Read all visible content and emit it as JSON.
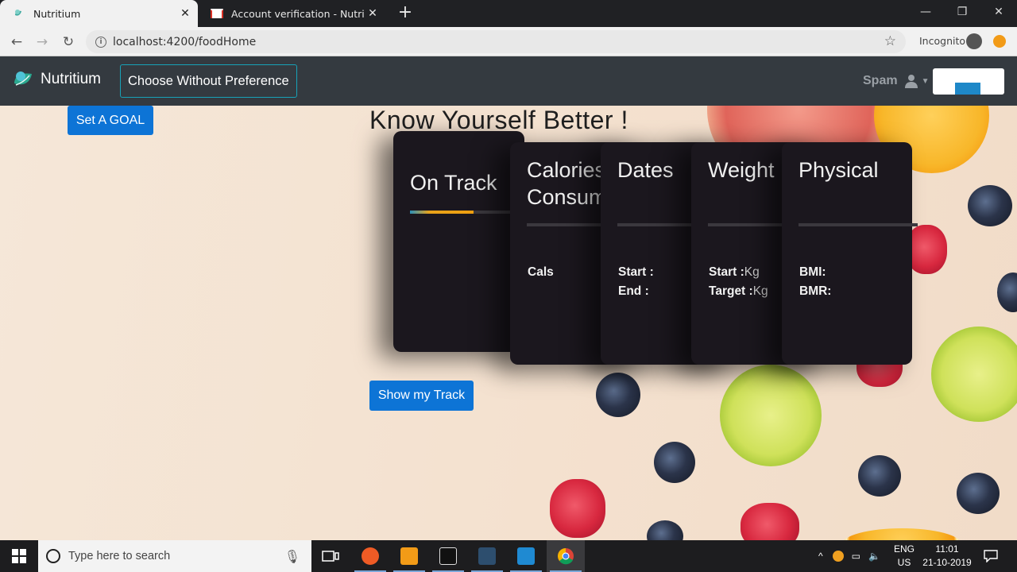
{
  "browser": {
    "tabs": [
      {
        "title": "Nutritium",
        "active": true
      },
      {
        "title": "Account verification - Nutritium -",
        "active": false
      }
    ],
    "url": "localhost:4200/foodHome",
    "incognito_label": "Incognito"
  },
  "navbar": {
    "brand": "Nutritium",
    "choose_label": "Choose Without Preference",
    "user_name": "Spam"
  },
  "page": {
    "goal_button": "Set A GOAL",
    "headline": "Know Yourself Better !",
    "track_button": "Show my Track",
    "on_track_progress_percent": 55
  },
  "cards": {
    "on_track": {
      "title": "On Track"
    },
    "calories": {
      "title": "Calories\nConsumed",
      "line1": "Cals"
    },
    "dates": {
      "title": "Dates",
      "line1": "Start :",
      "line2": "End :"
    },
    "weight": {
      "title": "Weight",
      "line1_label": "Start :",
      "line1_unit": "Kg",
      "line2_label": "Target :",
      "line2_unit": "Kg"
    },
    "physical": {
      "title": "Physical",
      "line1": "BMI:",
      "line2": "BMR:"
    }
  },
  "taskbar": {
    "search_placeholder": "Type here to search",
    "lang_line1": "ENG",
    "lang_line2": "US",
    "time": "11:01",
    "date": "21-10-2019"
  },
  "colors": {
    "primary_button": "#0d74d6",
    "navbar_bg": "#343a40",
    "card_bg": "#1b171e",
    "outline_button": "#17a2b8"
  }
}
